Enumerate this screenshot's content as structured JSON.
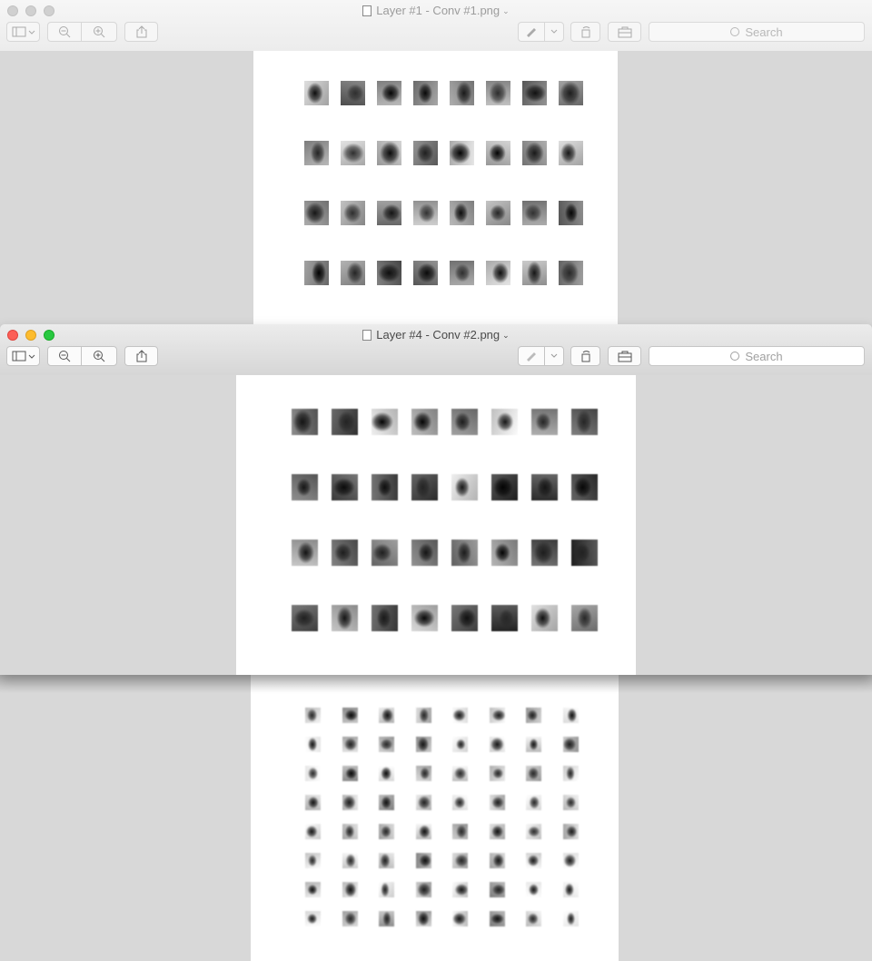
{
  "bottom_window": {
    "title": "Layer #1 - Conv #1.png",
    "search_placeholder": "Search",
    "grid": {
      "rows": 8,
      "cols": 8
    }
  },
  "top_window": {
    "title": "Layer #1 - Conv #1.png",
    "search_placeholder": "Search",
    "grid": {
      "rows": 4,
      "cols": 8
    }
  },
  "front_window": {
    "title": "Layer #4 - Conv #2.png",
    "search_placeholder": "Search",
    "grid": {
      "rows": 4,
      "cols": 8
    }
  },
  "toolbar_icons": [
    "sidebar-icon",
    "zoom-out-icon",
    "zoom-in-icon",
    "share-icon",
    "markup-pen-icon",
    "chevron-down-icon",
    "rotate-icon",
    "toolbox-icon",
    "search-icon"
  ],
  "colors": {
    "window_bg": "#d8d8d8",
    "page_bg": "#ffffff",
    "close": "#fc5f57",
    "minimize": "#fdbc2e",
    "zoom": "#28c840"
  }
}
